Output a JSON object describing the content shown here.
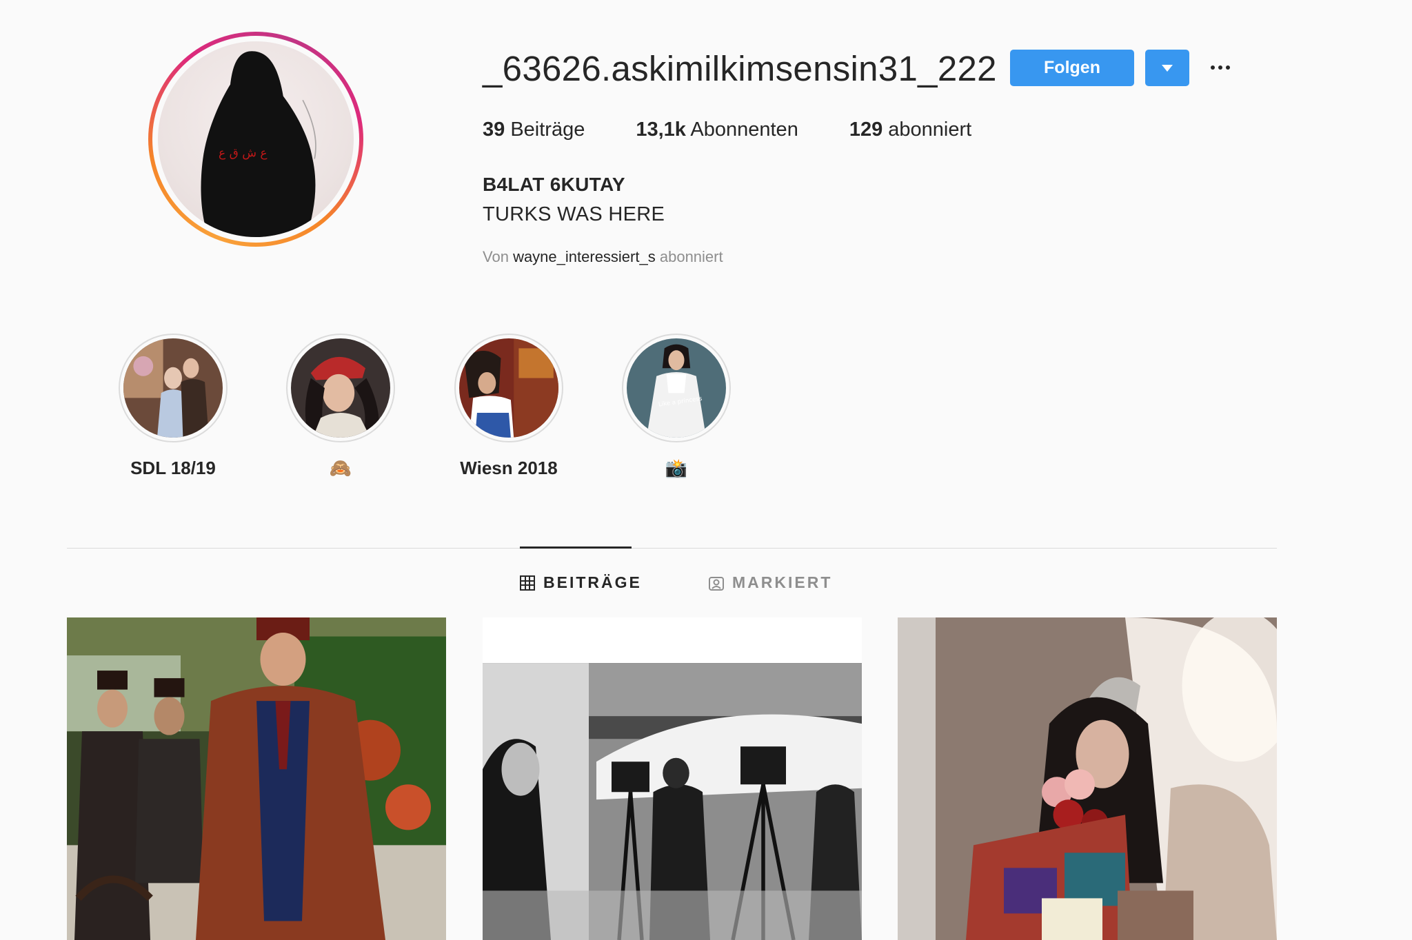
{
  "profile": {
    "username": "_63626.askimilkimsensin31_222",
    "follow_label": "Folgen",
    "stats": {
      "posts_count": "39",
      "posts_label": "Beiträge",
      "followers_count": "13,1k",
      "followers_label": "Abonnenten",
      "following_count": "129",
      "following_label": "abonniert"
    },
    "full_name": "B4LAT 6KUTAY",
    "bio": "TURKS WAS HERE",
    "followed_by": {
      "prefix": "Von",
      "user": "wayne_interessiert_s",
      "suffix": "abonniert"
    }
  },
  "highlights": [
    {
      "label": "SDL 18/19"
    },
    {
      "label": "🙈"
    },
    {
      "label": "Wiesn 2018"
    },
    {
      "label": "📸"
    }
  ],
  "tabs": [
    {
      "label": "BEITRÄGE",
      "active": true,
      "icon": "grid-icon"
    },
    {
      "label": "MARKIERT",
      "active": false,
      "icon": "tagged-icon"
    }
  ],
  "colors": {
    "accent": "#3897f0",
    "text": "#262626",
    "muted": "#8e8e8e",
    "divider": "#dbdbdb"
  }
}
